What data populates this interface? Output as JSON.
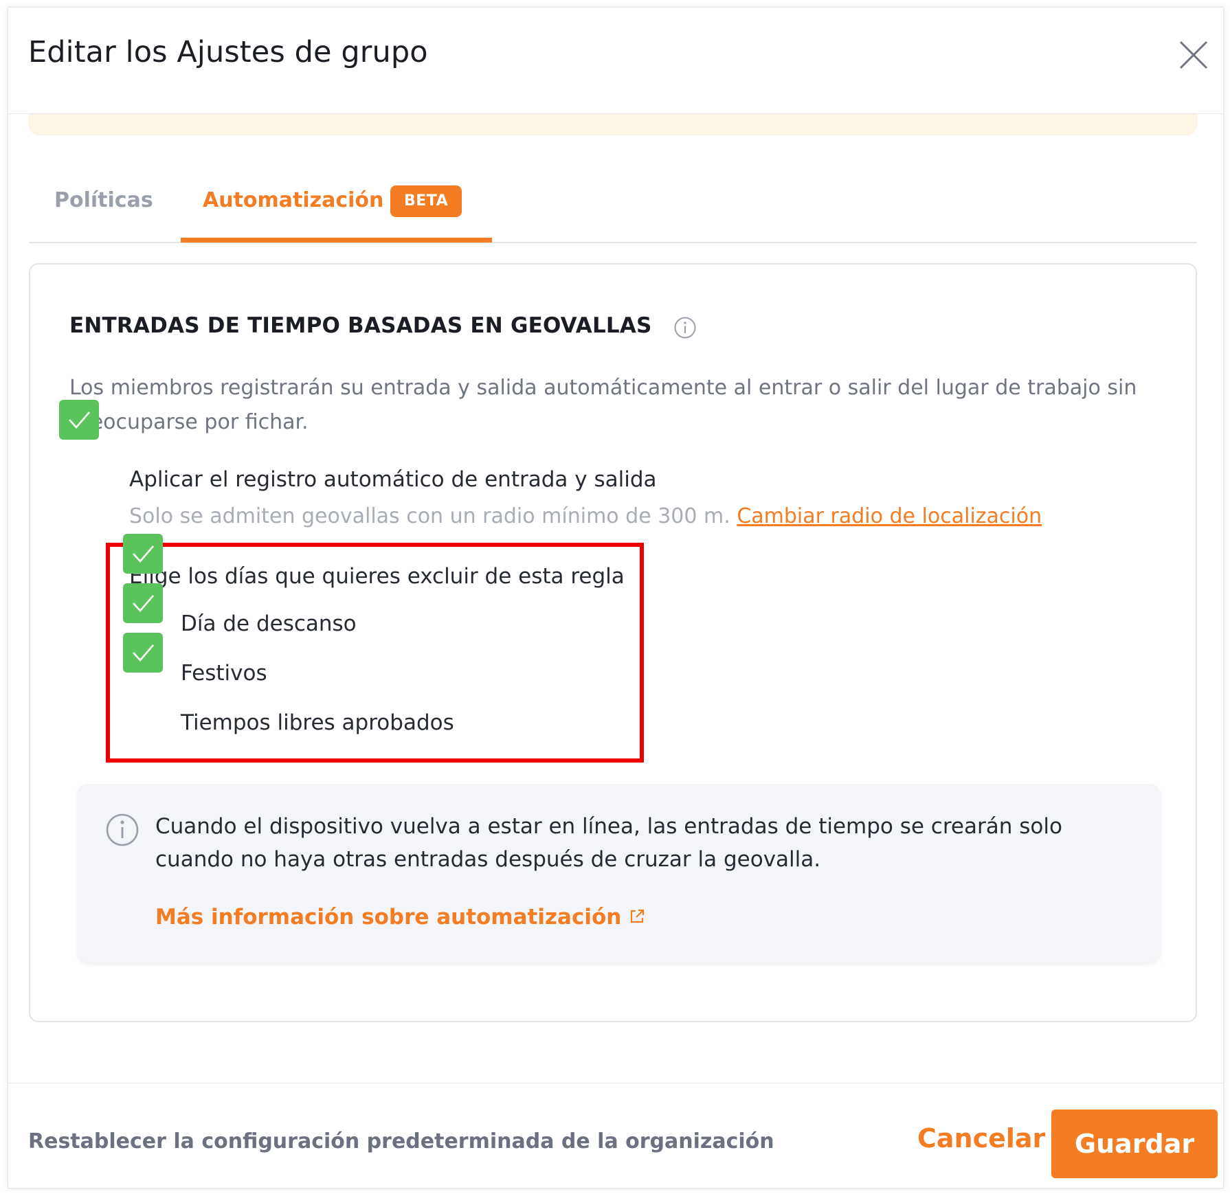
{
  "dialog": {
    "title": "Editar los Ajustes de grupo"
  },
  "tabs": [
    {
      "label": "Políticas",
      "active": false
    },
    {
      "label": "Automatización",
      "badge": "BETA",
      "active": true
    }
  ],
  "section": {
    "title": "ENTRADAS DE TIEMPO BASADAS EN GEOVALLAS",
    "description": "Los miembros registrarán su entrada y salida automáticamente al entrar o salir del lugar de trabajo sin preocuparse por fichar."
  },
  "auto_clock": {
    "label": "Aplicar el registro automático de entrada y salida",
    "checked": true,
    "note": "Solo se admiten geovallas con un radio mínimo de 300 m.",
    "link_label": "Cambiar radio de localización"
  },
  "exclusions": {
    "title": "Elige los días que quieres excluir de esta regla",
    "options": [
      {
        "label": "Día de descanso",
        "checked": true
      },
      {
        "label": "Festivos",
        "checked": true
      },
      {
        "label": "Tiempos libres aprobados",
        "checked": true
      }
    ]
  },
  "info": {
    "text": "Cuando el dispositivo vuelva a estar en línea, las entradas de tiempo se crearán solo cuando no haya otras entradas después de cruzar la geovalla.",
    "link_label": "Más información sobre automatización"
  },
  "footer": {
    "reset_label": "Restablecer la configuración predeterminada de la organización",
    "cancel_label": "Cancelar",
    "save_label": "Guardar"
  },
  "colors": {
    "accent": "#f47c22",
    "checkbox": "#5bc35b",
    "highlight": "#ee0000"
  },
  "icons": {
    "close": "close-icon",
    "info": "info-icon",
    "check": "check-icon",
    "external": "external-link-icon"
  }
}
